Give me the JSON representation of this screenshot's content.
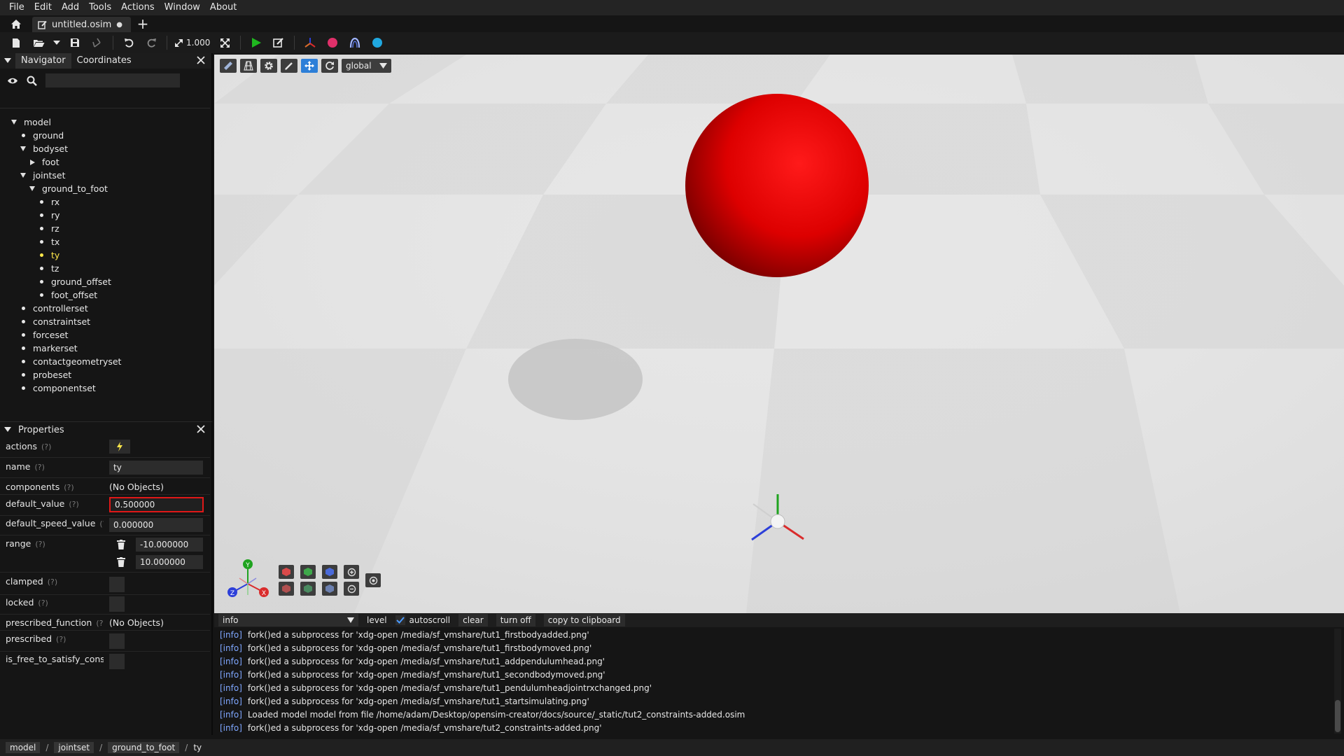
{
  "menu": [
    "File",
    "Edit",
    "Add",
    "Tools",
    "Actions",
    "Window",
    "About"
  ],
  "tabs": {
    "document": "untitled.osim",
    "modified_marker": "●",
    "add_label": "+"
  },
  "toolbar": {
    "zoom": "1.000"
  },
  "navigator": {
    "tabs": [
      "Navigator",
      "Coordinates"
    ],
    "search_placeholder": "",
    "tree": [
      {
        "label": "model",
        "depth": 0,
        "marker": "down"
      },
      {
        "label": "ground",
        "depth": 1,
        "marker": "bullet"
      },
      {
        "label": "bodyset",
        "depth": 1,
        "marker": "down"
      },
      {
        "label": "foot",
        "depth": 2,
        "marker": "right"
      },
      {
        "label": "jointset",
        "depth": 1,
        "marker": "down"
      },
      {
        "label": "ground_to_foot",
        "depth": 2,
        "marker": "down"
      },
      {
        "label": "rx",
        "depth": 3,
        "marker": "bullet"
      },
      {
        "label": "ry",
        "depth": 3,
        "marker": "bullet"
      },
      {
        "label": "rz",
        "depth": 3,
        "marker": "bullet"
      },
      {
        "label": "tx",
        "depth": 3,
        "marker": "bullet"
      },
      {
        "label": "ty",
        "depth": 3,
        "marker": "bullet",
        "selected": true
      },
      {
        "label": "tz",
        "depth": 3,
        "marker": "bullet"
      },
      {
        "label": "ground_offset",
        "depth": 3,
        "marker": "bullet"
      },
      {
        "label": "foot_offset",
        "depth": 3,
        "marker": "bullet"
      },
      {
        "label": "controllerset",
        "depth": 1,
        "marker": "bullet"
      },
      {
        "label": "constraintset",
        "depth": 1,
        "marker": "bullet"
      },
      {
        "label": "forceset",
        "depth": 1,
        "marker": "bullet"
      },
      {
        "label": "markerset",
        "depth": 1,
        "marker": "bullet"
      },
      {
        "label": "contactgeometryset",
        "depth": 1,
        "marker": "bullet"
      },
      {
        "label": "probeset",
        "depth": 1,
        "marker": "bullet"
      },
      {
        "label": "componentset",
        "depth": 1,
        "marker": "bullet"
      }
    ]
  },
  "properties": {
    "title": "Properties",
    "help": "(?)",
    "actions_label": "actions",
    "name_label": "name",
    "name_value": "ty",
    "components_label": "components",
    "components_value": "(No Objects)",
    "default_value_label": "default_value",
    "default_value": "0.500000",
    "default_speed_value_label": "default_speed_value",
    "default_speed_value": "0.000000",
    "range_label": "range",
    "range_min": "-10.000000",
    "range_max": "10.000000",
    "clamped_label": "clamped",
    "locked_label": "locked",
    "prescribed_function_label": "prescribed_function",
    "prescribed_function_value": "(No Objects)",
    "prescribed_label": "prescribed",
    "is_free_label": "is_free_to_satisfy_constraints"
  },
  "viewport": {
    "frame_dropdown": "global",
    "axes_labels": {
      "x": "X",
      "y": "Y",
      "z": "Z"
    },
    "colors": {
      "sphere": "#e00000",
      "floor": "#e6e6e6",
      "x_axis": "#d92c2c",
      "y_axis": "#1fa31f",
      "z_axis": "#2c3fd9"
    }
  },
  "log": {
    "level": "info",
    "level_label": "level",
    "autoscroll_label": "autoscroll",
    "clear_label": "clear",
    "turn_off_label": "turn off",
    "copy_label": "copy to clipboard",
    "lines": [
      {
        "level": "[info]",
        "message": "fork()ed a subprocess for 'xdg-open /media/sf_vmshare/tut1_firstbodyadded.png'"
      },
      {
        "level": "[info]",
        "message": "fork()ed a subprocess for 'xdg-open /media/sf_vmshare/tut1_firstbodymoved.png'"
      },
      {
        "level": "[info]",
        "message": "fork()ed a subprocess for 'xdg-open /media/sf_vmshare/tut1_addpendulumhead.png'"
      },
      {
        "level": "[info]",
        "message": "fork()ed a subprocess for 'xdg-open /media/sf_vmshare/tut1_secondbodymoved.png'"
      },
      {
        "level": "[info]",
        "message": "fork()ed a subprocess for 'xdg-open /media/sf_vmshare/tut1_pendulumheadjointrxchanged.png'"
      },
      {
        "level": "[info]",
        "message": "fork()ed a subprocess for 'xdg-open /media/sf_vmshare/tut1_startsimulating.png'"
      },
      {
        "level": "[info]",
        "message": "Loaded model model from file /home/adam/Desktop/opensim-creator/docs/source/_static/tut2_constraints-added.osim"
      },
      {
        "level": "[info]",
        "message": "fork()ed a subprocess for 'xdg-open /media/sf_vmshare/tut2_constraints-added.png'"
      }
    ]
  },
  "breadcrumb": {
    "items": [
      "model",
      "jointset",
      "ground_to_foot"
    ],
    "current": "ty",
    "separator": "/"
  }
}
